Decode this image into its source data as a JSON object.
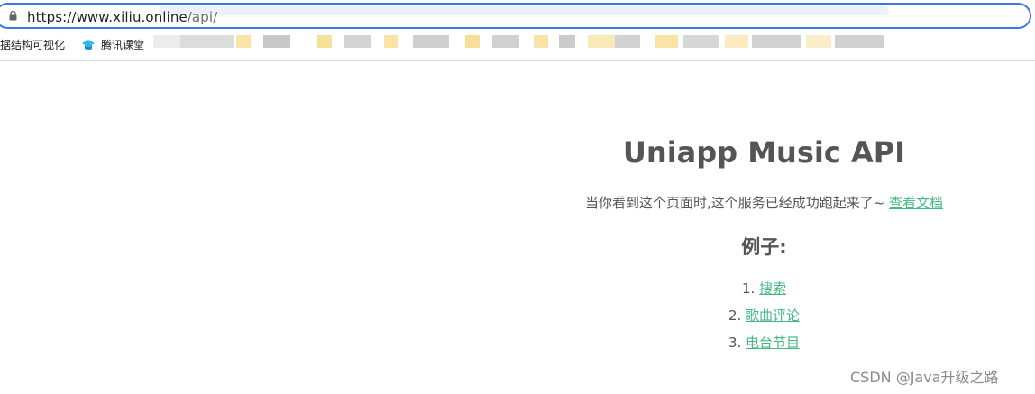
{
  "browser": {
    "url_host": "https://www.xiliu.online",
    "url_path": "/api/",
    "bookmarks": [
      {
        "label": "据结构可视化"
      },
      {
        "label": "腾讯课堂",
        "icon": "tencent-classroom-icon"
      }
    ]
  },
  "page": {
    "title": "Uniapp Music API",
    "intro_text": "当你看到这个页面时,这个服务已经成功跑起来了~ ",
    "docs_link": "查看文档",
    "examples_heading": "例子:",
    "examples": [
      {
        "num": "1.",
        "label": "搜索"
      },
      {
        "num": "2.",
        "label": "歌曲评论"
      },
      {
        "num": "3.",
        "label": "电台节目"
      }
    ]
  },
  "watermark": "CSDN @Java升级之路",
  "colors": {
    "link": "#42b983",
    "text": "#555555",
    "focus_ring": "#3b78e7"
  }
}
